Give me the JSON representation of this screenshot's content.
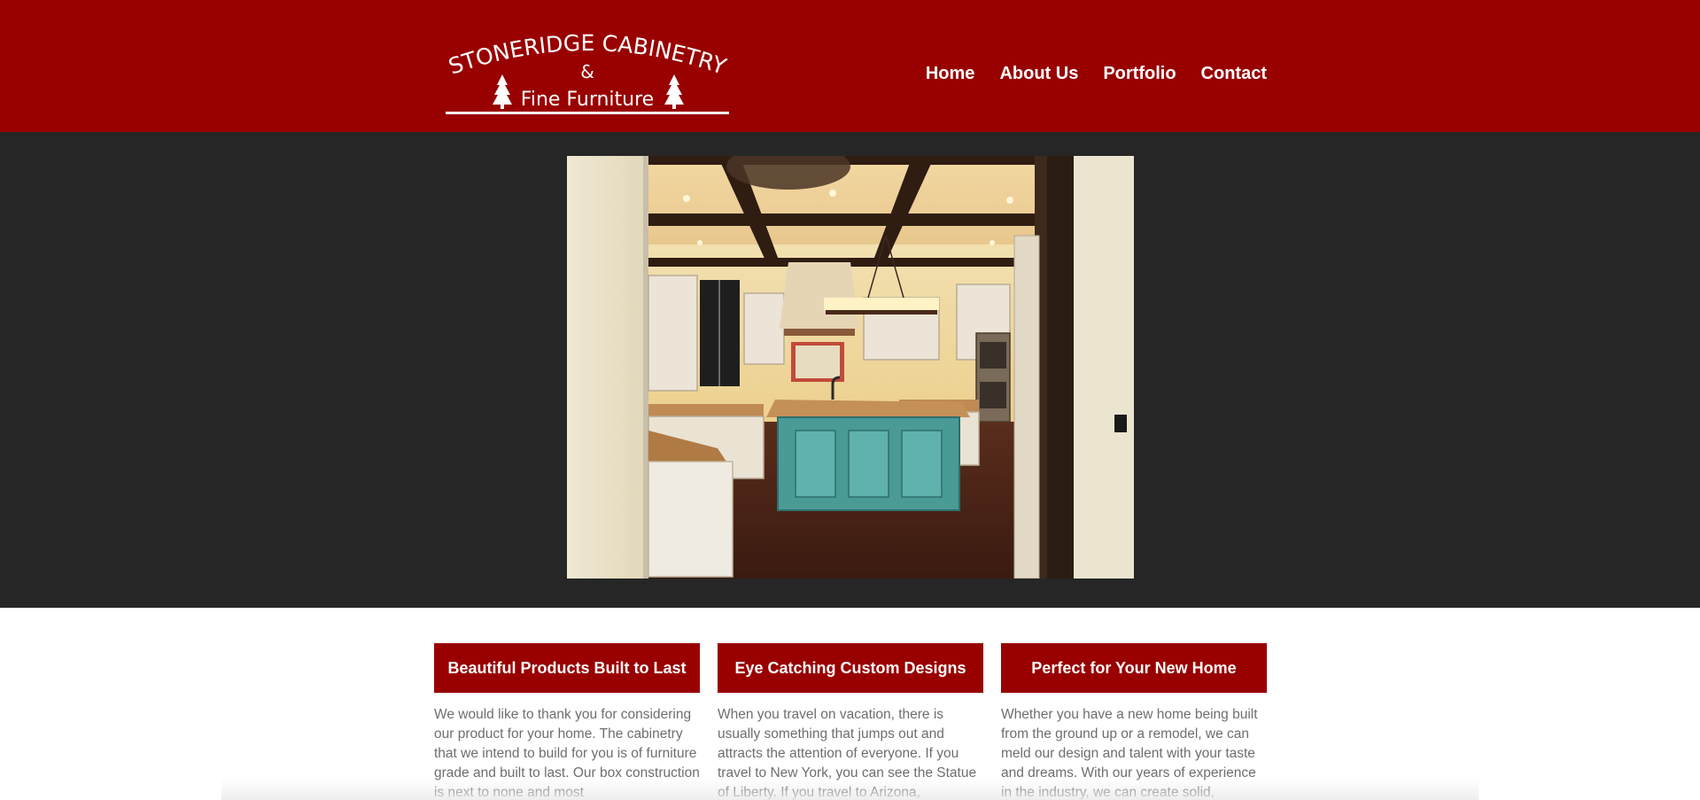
{
  "header": {
    "logo": {
      "line1": "STONERIDGE CABINETRY",
      "line2": "&",
      "line3": "Fine Furniture"
    },
    "nav": [
      {
        "label": "Home"
      },
      {
        "label": "About Us"
      },
      {
        "label": "Portfolio"
      },
      {
        "label": "Contact"
      }
    ],
    "brand_color": "#990000"
  },
  "hero": {
    "image": "kitchen-photo",
    "background": "#262626"
  },
  "features": [
    {
      "title": "Beautiful Products Built to Last",
      "text": "We would like to thank you for considering our product for your home. The cabinetry that we intend to build for you is of furniture grade and built to last. Our box construction is next to none and most"
    },
    {
      "title": "Eye Catching Custom Designs",
      "text": "When you travel on vacation, there is usually something that jumps out and attracts the attention of everyone. If you travel to New York, you can see the Statue of Liberty. If you travel to Arizona,"
    },
    {
      "title": "Perfect for Your New Home",
      "text": "Whether you have a new home being built from the ground up or a remodel, we can meld our design and talent with your taste and dreams. With our years of experience in the industry, we can create solid,"
    }
  ]
}
